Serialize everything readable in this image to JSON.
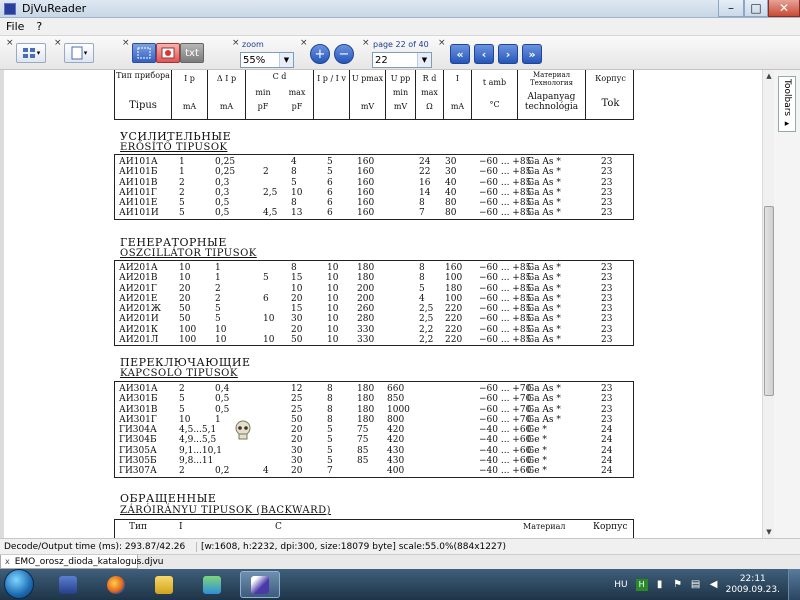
{
  "window": {
    "title": "DjVuReader"
  },
  "window_controls": {
    "minimize": "–",
    "maximize": "□",
    "close": "✕"
  },
  "menu": {
    "items": [
      "File",
      "?"
    ]
  },
  "toolbar": {
    "zoom_label": "zoom",
    "zoom_value": "55%",
    "page_label": "page 22 of 40",
    "page_value": "22",
    "text_button": "txt",
    "zoom_in": "+",
    "zoom_out": "−",
    "nav": {
      "first": "«",
      "prev": "‹",
      "next": "›",
      "last": "»"
    }
  },
  "side_panel": {
    "tab_label": "Toolbars ▸"
  },
  "document": {
    "header": {
      "col1_top": "Тип прибора",
      "col1_bottom": "Tipus",
      "col2_top": "I p",
      "col2_bottom": "mA",
      "col3_top": "Δ I p",
      "col3_bottom": "mA",
      "col4_top": "C d",
      "col4_min": "min",
      "col4_max": "max",
      "col4_unit_min": "pF",
      "col4_unit_max": "pF",
      "col5_top": "I p / I v",
      "col6_top": "U pmax",
      "col6_bottom": "mV",
      "col7_top": "U pp",
      "col7_mid": "min",
      "col7_bottom": "mV",
      "col8_top": "R d",
      "col8_mid": "max",
      "col8_bottom": "Ω",
      "col9_top": "I",
      "col9_bottom": "mA",
      "col10_top": "t amb",
      "col10_bottom": "°C",
      "col11_top": "Материал Технология",
      "col11_bottom": "Alapanyag technológia",
      "col12_top": "Корпус",
      "col12_bottom": "Tok"
    },
    "sections": [
      {
        "title_ru": "УСИЛИТЕЛЬНЫЕ",
        "title_hu": "ERŐSÍTŐ TIPUSOK",
        "rows": [
          [
            "АИ101А",
            "1",
            "0,25",
            "",
            "4",
            "5",
            "160",
            "",
            "24",
            "30",
            "−60 ... +85",
            "Ga As *",
            "23"
          ],
          [
            "АИ101Б",
            "1",
            "0,25",
            "2",
            "8",
            "5",
            "160",
            "",
            "22",
            "30",
            "−60 ... +85",
            "Ga As *",
            "23"
          ],
          [
            "АИ101В",
            "2",
            "0,3",
            "",
            "5",
            "6",
            "160",
            "",
            "16",
            "40",
            "−60 ... +85",
            "Ga As *",
            "23"
          ],
          [
            "АИ101Г",
            "2",
            "0,3",
            "2,5",
            "10",
            "6",
            "160",
            "",
            "14",
            "40",
            "−60 ... +85",
            "Ga As *",
            "23"
          ],
          [
            "АИ101Е",
            "5",
            "0,5",
            "",
            "8",
            "6",
            "160",
            "",
            "8",
            "80",
            "−60 ... +85",
            "Ga As *",
            "23"
          ],
          [
            "АИ101И",
            "5",
            "0,5",
            "4,5",
            "13",
            "6",
            "160",
            "",
            "7",
            "80",
            "−60 ... +85",
            "Ga As *",
            "23"
          ]
        ]
      },
      {
        "title_ru": "ГЕНЕРАТОРНЫЕ",
        "title_hu": "OSZCILLÁTOR TIPUSOK",
        "rows": [
          [
            "АИ201А",
            "10",
            "1",
            "",
            "8",
            "10",
            "180",
            "",
            "8",
            "160",
            "−60 ... +85",
            "Ga As *",
            "23"
          ],
          [
            "АИ201В",
            "10",
            "1",
            "5",
            "15",
            "10",
            "180",
            "",
            "8",
            "100",
            "−60 ... +85",
            "Ga As *",
            "23"
          ],
          [
            "АИ201Г",
            "20",
            "2",
            "",
            "10",
            "10",
            "200",
            "",
            "5",
            "180",
            "−60 ... +85",
            "Ga As *",
            "23"
          ],
          [
            "АИ201Е",
            "20",
            "2",
            "6",
            "20",
            "10",
            "200",
            "",
            "4",
            "100",
            "−60 ... +85",
            "Ga As *",
            "23"
          ],
          [
            "АИ201Ж",
            "50",
            "5",
            "",
            "15",
            "10",
            "260",
            "",
            "2,5",
            "220",
            "−60 ... +85",
            "Ga As *",
            "23"
          ],
          [
            "АИ201И",
            "50",
            "5",
            "10",
            "30",
            "10",
            "280",
            "",
            "2,5",
            "220",
            "−60 ... +85",
            "Ga As *",
            "23"
          ],
          [
            "АИ201К",
            "100",
            "10",
            "",
            "20",
            "10",
            "330",
            "",
            "2,2",
            "220",
            "−60 ... +85",
            "Ga As *",
            "23"
          ],
          [
            "АИ201Л",
            "100",
            "10",
            "10",
            "50",
            "10",
            "330",
            "",
            "2,2",
            "220",
            "−60 ... +85",
            "Ga As *",
            "23"
          ]
        ]
      },
      {
        "title_ru": "ПЕРЕКЛЮЧАЮЩИЕ",
        "title_hu": "KAPCSOLÓ TIPUSOK",
        "rows": [
          [
            "АИ301А",
            "2",
            "0,4",
            "",
            "12",
            "8",
            "180",
            "660",
            "",
            "",
            "−60 ... +70",
            "Ga As *",
            "23"
          ],
          [
            "АИ301Б",
            "5",
            "0,5",
            "",
            "25",
            "8",
            "180",
            "850",
            "",
            "",
            "−60 ... +70",
            "Ga As *",
            "23"
          ],
          [
            "АИ301В",
            "5",
            "0,5",
            "",
            "25",
            "8",
            "180",
            "1000",
            "",
            "",
            "−60 ... +70",
            "Ga As *",
            "23"
          ],
          [
            "АИ301Г",
            "10",
            "1",
            "",
            "50",
            "8",
            "180",
            "800",
            "",
            "",
            "−60 ... +70",
            "Ga As *",
            "23"
          ],
          [
            "ГИ304А",
            "4,5...5,1",
            "",
            "",
            "20",
            "5",
            "75",
            "420",
            "",
            "",
            "−40 ... +60",
            "Ge *",
            "24"
          ],
          [
            "ГИ304Б",
            "4,9...5,5",
            "",
            "",
            "20",
            "5",
            "75",
            "420",
            "",
            "",
            "−40 ... +60",
            "Ge *",
            "24"
          ],
          [
            "ГИ305А",
            "9,1...10,1",
            "",
            "",
            "30",
            "5",
            "85",
            "430",
            "",
            "",
            "−40 ... +60",
            "Ge *",
            "24"
          ],
          [
            "ГИ305Б",
            "9,8...11",
            "",
            "",
            "30",
            "5",
            "85",
            "430",
            "",
            "",
            "−40 ... +60",
            "Ge *",
            "24"
          ],
          [
            "ГИ307А",
            "2",
            "0,2",
            "4",
            "20",
            "7",
            "",
            "400",
            "",
            "",
            "−40 ... +60",
            "Ge *",
            "24"
          ]
        ]
      },
      {
        "title_ru": "ОБРАЩЕННЫЕ",
        "title_hu": "ZÁRÓIRÁNYU TIPUSOK (BACKWARD)",
        "rows": []
      }
    ],
    "header_partial_last": [
      "Тип",
      "I",
      "C",
      "Материал",
      "Корпус"
    ]
  },
  "status_bar": {
    "timing": "Decode/Output time (ms): 293.87/42.26",
    "info": "[w:1608, h:2232, dpi:300, size:18079 byte] scale:55.0%(884x1227)"
  },
  "file_tab": {
    "name": "EMO_orosz_dioda_katalogus.djvu",
    "close": "x"
  },
  "taskbar": {
    "apps": [
      "start",
      "media-player",
      "firefox",
      "people",
      "djvureader"
    ],
    "language": "HU",
    "time": "22:11",
    "date": "2009.09.23."
  }
}
